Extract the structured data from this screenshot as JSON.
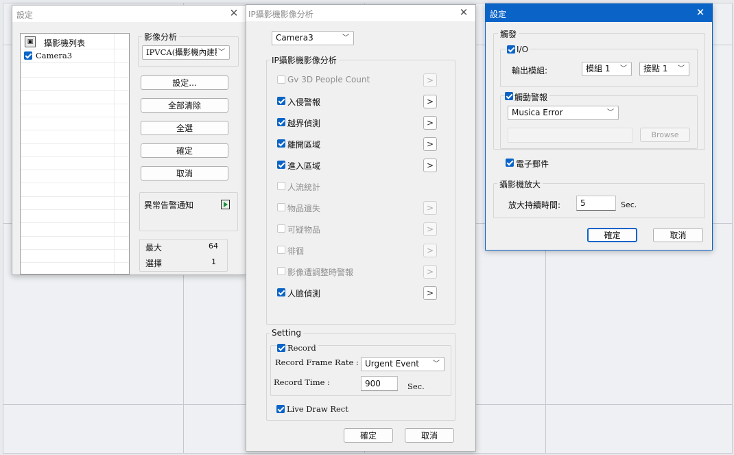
{
  "settings_window": {
    "title": "設定",
    "camera_list_header": "攝影機列表",
    "cameras": [
      {
        "name": "Camera3",
        "checked": true
      }
    ],
    "video_analysis_label": "影像分析",
    "video_analysis_value": "IPVCA(攝影機內建影",
    "buttons": {
      "setup": "設定...",
      "clear_all": "全部清除",
      "select_all": "全選",
      "ok": "確定",
      "cancel": "取消"
    },
    "abnormal_alert_label": "異常告警通知",
    "max_label": "最大",
    "max_value": "64",
    "selected_label": "選擇",
    "selected_value": "1"
  },
  "ipva_window": {
    "title": "IP攝影機影像分析",
    "camera_select": "Camera3",
    "group_label": "IP攝影機影像分析",
    "items": [
      {
        "label": "Gv 3D People Count",
        "checked": false,
        "enabled": false,
        "has_button": true,
        "button_enabled": false
      },
      {
        "label": "入侵警報",
        "checked": true,
        "enabled": true,
        "has_button": true,
        "button_enabled": true
      },
      {
        "label": "越界偵測",
        "checked": true,
        "enabled": true,
        "has_button": true,
        "button_enabled": true
      },
      {
        "label": "離開區域",
        "checked": true,
        "enabled": true,
        "has_button": true,
        "button_enabled": true
      },
      {
        "label": "進入區域",
        "checked": true,
        "enabled": true,
        "has_button": true,
        "button_enabled": true
      },
      {
        "label": "人流統計",
        "checked": false,
        "enabled": false,
        "has_button": false,
        "button_enabled": false
      },
      {
        "label": "物品遺失",
        "checked": false,
        "enabled": false,
        "has_button": true,
        "button_enabled": false
      },
      {
        "label": "可疑物品",
        "checked": false,
        "enabled": false,
        "has_button": true,
        "button_enabled": false
      },
      {
        "label": "徘徊",
        "checked": false,
        "enabled": false,
        "has_button": true,
        "button_enabled": false
      },
      {
        "label": "影像遭調整時警報",
        "checked": false,
        "enabled": false,
        "has_button": true,
        "button_enabled": false
      },
      {
        "label": "人臉偵測",
        "checked": true,
        "enabled": true,
        "has_button": true,
        "button_enabled": true
      }
    ],
    "arrow_glyph": ">",
    "setting_group": "Setting",
    "record_label": "Record",
    "record_checked": true,
    "record_frame_rate_label": "Record Frame Rate :",
    "record_frame_rate_value": "Urgent Event",
    "record_time_label": "Record Time :",
    "record_time_value": "900",
    "record_time_unit": "Sec.",
    "live_draw_rect_label": "Live Draw Rect",
    "live_draw_rect_checked": true,
    "ok": "確定",
    "cancel": "取消"
  },
  "trigger_window": {
    "title": "設定",
    "trigger_group": "觸發",
    "io_label": "I/O",
    "io_checked": true,
    "output_module_label": "輸出模組:",
    "module_value": "模組 1",
    "contact_value": "接點 1",
    "alarm_label": "觸動警報",
    "alarm_checked": true,
    "alarm_sound": "Musica Error",
    "browse_label": "Browse",
    "email_label": "電子郵件",
    "email_checked": true,
    "zoom_group": "攝影機放大",
    "zoom_duration_label": "放大持續時間:",
    "zoom_duration_value": "5",
    "zoom_unit": "Sec.",
    "ok": "確定",
    "cancel": "取消"
  },
  "colors": {
    "accent": "#0a64c8",
    "window_bg": "#f0f0f0",
    "desktop_bg": "#eef0f3"
  }
}
